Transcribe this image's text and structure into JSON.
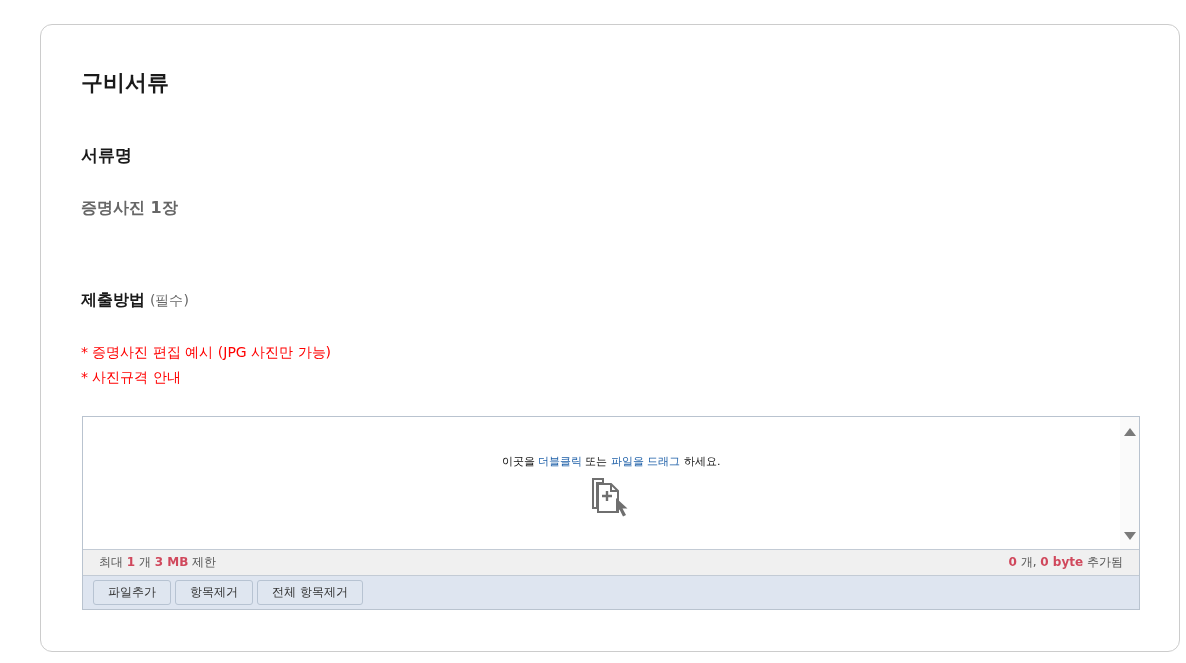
{
  "section": {
    "title": "구비서류"
  },
  "document": {
    "label": "서류명",
    "value": "증명사진 1장"
  },
  "submission": {
    "label": "제출방법",
    "note": "(필수)",
    "links": [
      "* 증명사진 편집 예시 (JPG 사진만 가능)",
      "* 사진규격 안내"
    ]
  },
  "uploader": {
    "drop_hint": [
      {
        "text": "이곳을 ",
        "highlight": false
      },
      {
        "text": "더블클릭",
        "highlight": true
      },
      {
        "text": " 또는 ",
        "highlight": false
      },
      {
        "text": "파일을 드래그",
        "highlight": true
      },
      {
        "text": " 하세요.",
        "highlight": false
      }
    ],
    "limit": "최대 **1** 개 **3 MB** 제한",
    "added": "**0** 개, **0 byte** 추가됨",
    "buttons": [
      "파일추가",
      "항목제거",
      "전체 항목제거"
    ]
  }
}
